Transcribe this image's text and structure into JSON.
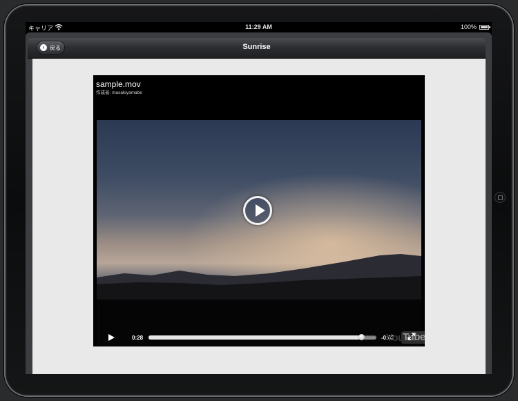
{
  "status_bar": {
    "carrier": "キャリア",
    "time": "11:29 AM",
    "battery": "100%"
  },
  "navbar": {
    "title": "Sunrise",
    "back_label": "戻る"
  },
  "video": {
    "title": "sample.mov",
    "author_line": "作成者: masakiyamabe",
    "elapsed": "0:28",
    "remaining": "-0:02",
    "progress": 0.9333,
    "brand_you": "You",
    "brand_tube": "Tube"
  },
  "colors": {
    "screen_bg": "#e9e9e9",
    "navbar": "#2b2d30",
    "video_bg": "#000000"
  }
}
